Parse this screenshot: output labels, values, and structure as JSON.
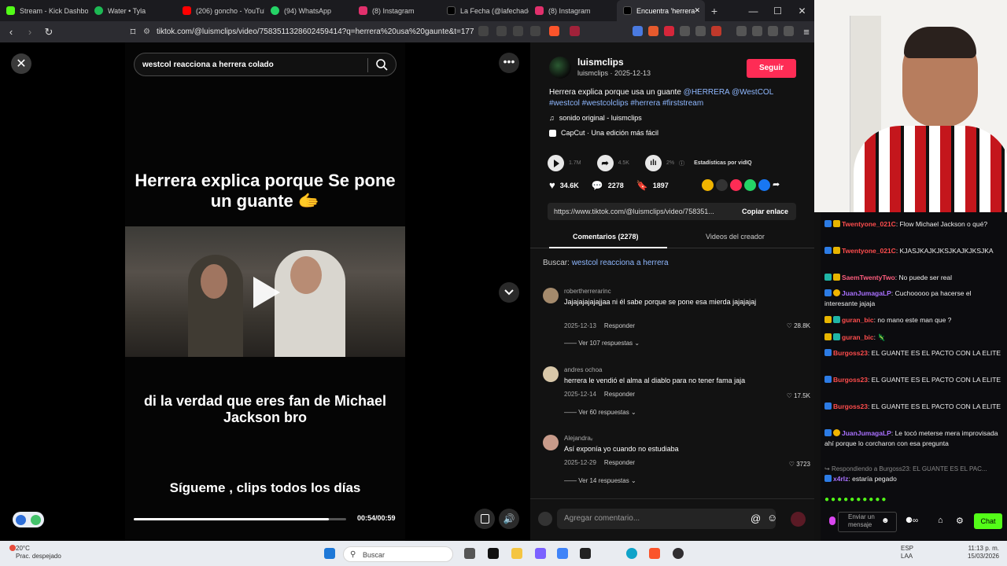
{
  "browser": {
    "tabs": [
      {
        "label": "Stream - Kick Dashboard",
        "color": "#53fc18"
      },
      {
        "label": "Water • Tyla",
        "color": "#1db954"
      },
      {
        "label": "(206) goncho - YouTube",
        "color": "#ff0000"
      },
      {
        "label": "(94) WhatsApp",
        "color": "#25d366"
      },
      {
        "label": "(8) Instagram",
        "color": "#e1306c"
      },
      {
        "label": "La Fecha (@lafechade",
        "color": "#000000"
      },
      {
        "label": "(8) Instagram",
        "color": "#e1306c"
      },
      {
        "label": "Encuentra 'herrera",
        "color": "#000000"
      }
    ],
    "url": "tiktok.com/@luismclips/video/7583511328602459414?q=herrera%20usa%20gaunte&t=17736...",
    "window_controls": [
      "—",
      "☐",
      "✕"
    ]
  },
  "video": {
    "search_text": "westcol reacciona a herrera colado",
    "caption_top": "Herrera explica porque Se pone un guante 🫱",
    "caption_mid": "di la verdad que eres fan de Michael Jackson bro",
    "caption_bottom": "Sígueme , clips todos los días",
    "progress": 0.92,
    "time": "00:54/00:59"
  },
  "panel": {
    "author_name": "luismclips",
    "author_sub": "luismclips · 2025-12-13",
    "follow_label": "Seguir",
    "description": "Herrera explica porque usa un guante",
    "hashtags": "@HERRERA @WestCOL #westcol #westcolclips #herrera #firststream",
    "sound": "sonido original - luismclips",
    "capcut": "CapCut · Una edición más fácil",
    "stats_row1": {
      "views": "1.7M",
      "shares": "4.5K",
      "pct": "2%",
      "vidiq": "Estadísticas por vidIQ"
    },
    "likes": "34.6K",
    "comments_count": "2278",
    "saves": "1897",
    "link": "https://www.tiktok.com/@luismclips/video/758351...",
    "copy_label": "Copiar enlace",
    "tab_comments": "Comentarios (2278)",
    "tab_videos": "Videos del creador",
    "buscar_label": "Buscar:",
    "buscar_query": "westcol reacciona a herrera",
    "comments": [
      {
        "user": "robertherrerarinc",
        "text": "Jajajajajajajjaa ni él sabe porque se pone esa mierda jajajajaj",
        "date": "2025-12-13",
        "reply": "Responder",
        "likes": "28.8K",
        "replies": "Ver 107 respuestas"
      },
      {
        "user": "andres ochoa",
        "text": "herrera le vendió el alma al diablo para no tener fama jaja",
        "date": "2025-12-14",
        "reply": "Responder",
        "likes": "17.5K",
        "replies": "Ver 60 respuestas"
      },
      {
        "user": "Alejandraᵥ",
        "text": "Así exponía yo cuando no estudiaba",
        "date": "2025-12-29",
        "reply": "Responder",
        "likes": "3723",
        "replies": "Ver 14 respuestas"
      }
    ],
    "add_comment_placeholder": "Agregar comentario..."
  },
  "chat": {
    "messages": [
      {
        "user": "Twentyone_021C",
        "text": "Flow Michael Jackson o qué?",
        "color": "#ff4d4d"
      },
      {
        "user": "Twentyone_021C",
        "text": "KJASJKAJKJKSJKAJKJKSJKA",
        "color": "#ff4d4d"
      },
      {
        "user": "SaemTwentyTwo",
        "text": "No puede ser real",
        "color": "#ff5e7e"
      },
      {
        "user": "JuanJumagaLP",
        "text": "Cuchooooo pa hacerse el interesante jajaja",
        "color": "#a970ff"
      },
      {
        "user": "guran_bic",
        "text": "no mano este man que ?",
        "color": "#ff4d4d"
      },
      {
        "user": "guran_bic",
        "text": "🦎",
        "color": "#ff4d4d"
      },
      {
        "user": "Burgoss23",
        "text": "EL GUANTE ES EL PACTO CON LA ELITE",
        "color": "#ff4d4d"
      },
      {
        "user": "Burgoss23",
        "text": "EL GUANTE ES EL PACTO CON LA ELITE",
        "color": "#ff4d4d"
      },
      {
        "user": "Burgoss23",
        "text": "EL GUANTE ES EL PACTO CON LA ELITE",
        "color": "#ff4d4d"
      },
      {
        "user": "JuanJumagaLP",
        "text": "Le tocó meterse mera improvisada ahí porque lo corcharon con esa pregunta",
        "color": "#a970ff"
      },
      {
        "user": "x4rlz",
        "text": "estaría pegado",
        "color": "#a970ff"
      }
    ],
    "reply_context": "Respondiendo a Burgoss23: EL GUANTE ES EL PAC...",
    "send_placeholder": "Enviar un mensaje",
    "chat_button": "Chat"
  },
  "taskbar": {
    "weather_temp": "20°C",
    "weather_desc": "Prac. despejado",
    "search": "Buscar",
    "lang": "ESP LAA",
    "time": "11:13 p. m.",
    "date": "15/03/2026"
  }
}
